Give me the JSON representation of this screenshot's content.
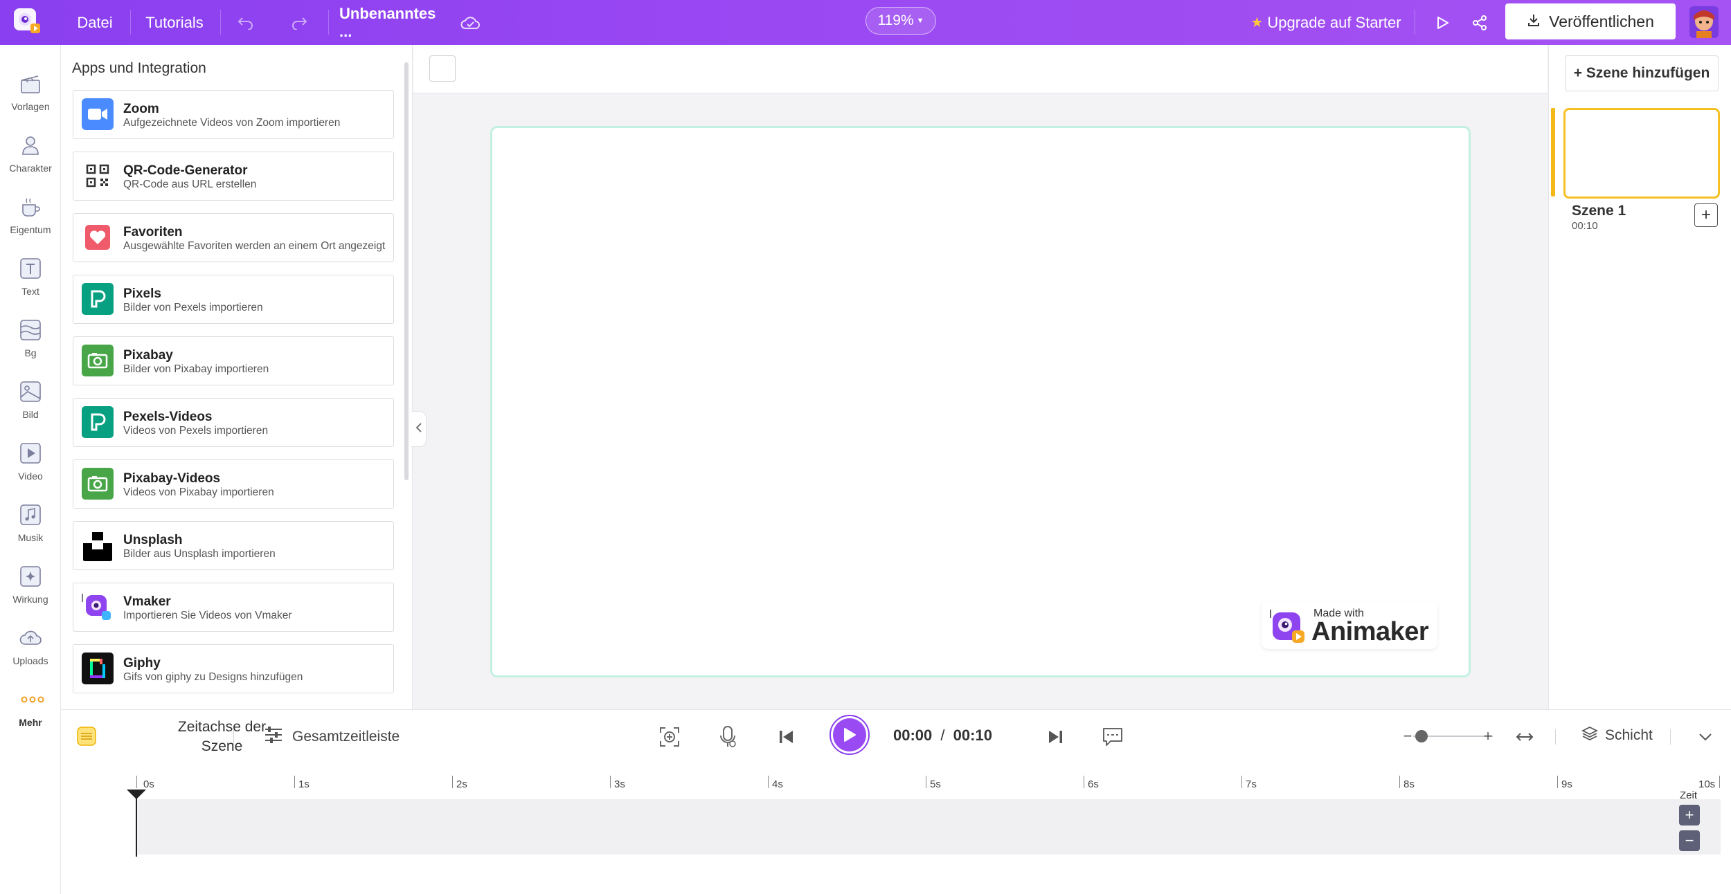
{
  "topbar": {
    "menu": [
      "Datei",
      "Tutorials"
    ],
    "project_title": "Unbenanntes ...",
    "zoom": "119%",
    "upgrade_label": "Upgrade auf Starter",
    "publish_label": "Veröffentlichen"
  },
  "rail": {
    "items": [
      {
        "label": "Vorlagen",
        "icon": "templates-icon"
      },
      {
        "label": "Charakter",
        "icon": "character-icon"
      },
      {
        "label": "Eigentum",
        "icon": "properties-icon"
      },
      {
        "label": "Text",
        "icon": "text-icon"
      },
      {
        "label": "Bg",
        "icon": "background-icon"
      },
      {
        "label": "Bild",
        "icon": "image-icon"
      },
      {
        "label": "Video",
        "icon": "video-icon"
      },
      {
        "label": "Musik",
        "icon": "music-icon"
      },
      {
        "label": "Wirkung",
        "icon": "effect-icon"
      },
      {
        "label": "Uploads",
        "icon": "upload-icon"
      },
      {
        "label": "Mehr",
        "icon": "more-icon"
      }
    ]
  },
  "panel": {
    "title": "Apps und Integration",
    "integrations": [
      {
        "title": "Zoom",
        "subtitle": "Aufgezeichnete Videos von Zoom importieren",
        "icon": "zoom-icon"
      },
      {
        "title": "QR-Code-Generator",
        "subtitle": "QR-Code aus URL erstellen",
        "icon": "qr-code-icon"
      },
      {
        "title": "Favoriten",
        "subtitle": "Ausgewählte Favoriten werden an einem Ort angezeigt",
        "icon": "heart-icon"
      },
      {
        "title": "Pixels",
        "subtitle": "Bilder von Pexels importieren",
        "icon": "pexels-icon"
      },
      {
        "title": "Pixabay",
        "subtitle": "Bilder von Pixabay importieren",
        "icon": "pixabay-icon"
      },
      {
        "title": "Pexels-Videos",
        "subtitle": "Videos von Pexels importieren",
        "icon": "pexels-icon"
      },
      {
        "title": "Pixabay-Videos",
        "subtitle": "Videos von Pixabay importieren",
        "icon": "pixabay-icon"
      },
      {
        "title": "Unsplash",
        "subtitle": "Bilder aus Unsplash importieren",
        "icon": "unsplash-icon"
      },
      {
        "title": "Vmaker",
        "subtitle": "Importieren Sie Videos von Vmaker",
        "icon": "vmaker-icon"
      },
      {
        "title": "Giphy",
        "subtitle": "Gifs von giphy zu Designs hinzufügen",
        "icon": "giphy-icon"
      }
    ]
  },
  "watermark": {
    "small": "Made with",
    "brand": "Animaker"
  },
  "scenes": {
    "add_label": "+ Szene hinzufügen",
    "items": [
      {
        "name": "Szene 1",
        "duration": "00:10"
      }
    ]
  },
  "controls": {
    "scene_timeline_label": "Zeitachse der Szene",
    "full_timeline_label": "Gesamtzeitleiste",
    "current_time": "00:00",
    "separator": "/",
    "total_time": "00:10",
    "layer_label": "Schicht"
  },
  "timeline": {
    "ticks": [
      "0s",
      "1s",
      "2s",
      "3s",
      "4s",
      "5s",
      "6s",
      "7s",
      "8s",
      "9s",
      "10s"
    ],
    "zeit_label": "Zeit"
  },
  "colors": {
    "brand_purple": "#9a48f2",
    "scene_highlight": "#f5b719",
    "stage_border": "#c3f0e0"
  }
}
